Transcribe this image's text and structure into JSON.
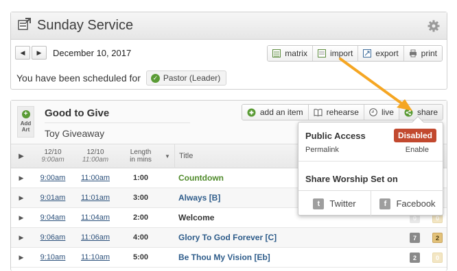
{
  "service": {
    "title": "Sunday Service",
    "date": "December 10, 2017",
    "toolbar": {
      "matrix": "matrix",
      "import": "import",
      "export": "export",
      "print": "print"
    },
    "scheduled_text": "You have been scheduled for",
    "role": "Pastor (Leader)"
  },
  "plan": {
    "add_art": [
      "Add",
      "Art"
    ],
    "title": "Good to Give",
    "subtitle": "Toy Giveaway",
    "buttons": {
      "add_item": "add an item",
      "rehearse": "rehearse",
      "live": "live",
      "share": "share"
    },
    "columns": {
      "time1_date": "12/10",
      "time1_time": "9:00am",
      "time2_date": "12/10",
      "time2_time": "11:00am",
      "length_top": "Length",
      "length_bottom": "in mins",
      "title": "Title"
    },
    "rows": [
      {
        "t1": "9:00am",
        "t2": "11:00am",
        "len": "1:00",
        "title": "Countdown",
        "color": "#4f8a2a",
        "k1": "",
        "k2": ""
      },
      {
        "t1": "9:01am",
        "t2": "11:01am",
        "len": "3:00",
        "title": "Always [B]",
        "color": "#2e5c8a",
        "k1": "",
        "k2": ""
      },
      {
        "t1": "9:04am",
        "t2": "11:04am",
        "len": "2:00",
        "title": "Welcome",
        "color": "#333333",
        "k1": "0",
        "k2": "0"
      },
      {
        "t1": "9:06am",
        "t2": "11:06am",
        "len": "4:00",
        "title": "Glory To God Forever [C]",
        "color": "#2e5c8a",
        "k1": "7",
        "k2": "2"
      },
      {
        "t1": "9:10am",
        "t2": "11:10am",
        "len": "5:00",
        "title": "Be Thou My Vision [Eb]",
        "color": "#2e5c8a",
        "k1": "2",
        "k2": "0"
      }
    ]
  },
  "share_popover": {
    "public_access": "Public Access",
    "status": "Disabled",
    "permalink": "Permalink",
    "enable": "Enable",
    "share_on": "Share Worship Set on",
    "twitter": "Twitter",
    "facebook": "Facebook"
  },
  "colors": {
    "accent_green": "#5a9b35",
    "disabled_red": "#c2492f",
    "annotation_orange": "#f5a623"
  }
}
